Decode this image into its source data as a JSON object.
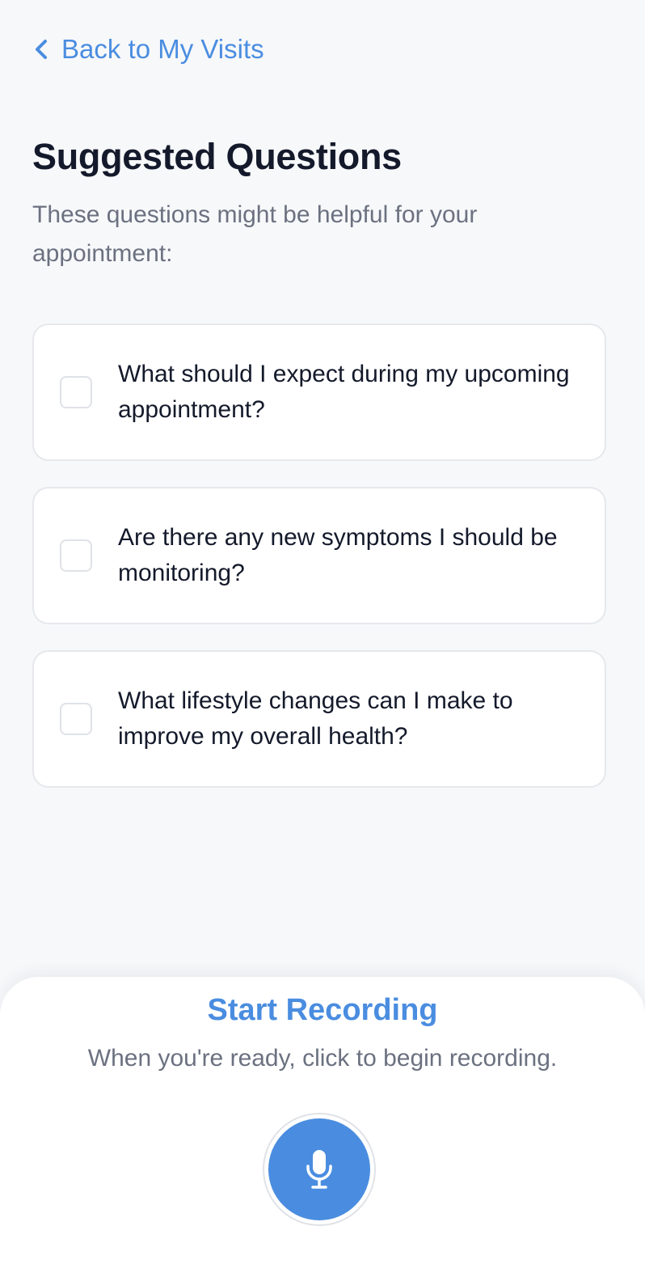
{
  "nav": {
    "back_label": "Back to My Visits"
  },
  "header": {
    "title": "Suggested Questions",
    "subtitle": "These questions might be helpful for your appointment:"
  },
  "questions": [
    {
      "text": "What should I expect during my upcoming appointment?",
      "checked": false
    },
    {
      "text": "Are there any new symptoms I should be monitoring?",
      "checked": false
    },
    {
      "text": "What lifestyle changes can I make to improve my overall health?",
      "checked": false
    }
  ],
  "recording": {
    "title": "Start Recording",
    "subtitle": "When you're ready, click to begin recording.",
    "button_icon": "microphone-icon"
  },
  "colors": {
    "accent": "#4a8de0",
    "text_primary": "#141a2b",
    "text_secondary": "#6b7180",
    "background": "#f7f8fa"
  }
}
